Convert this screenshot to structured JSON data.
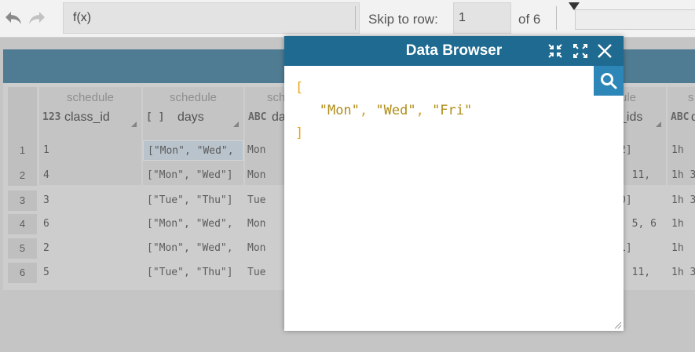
{
  "toolbar": {
    "formula": "f(x)",
    "skip_label": "Skip to row:",
    "skip_value": "1",
    "of_label": "of 6",
    "undo_icon": "undo-arrow-icon",
    "redo_icon": "redo-arrow-icon"
  },
  "grid": {
    "columns": [
      {
        "group": "schedule",
        "type": "123",
        "name": "class_id"
      },
      {
        "group": "schedule",
        "type": "[ ]",
        "name": "days"
      },
      {
        "group": "sche",
        "type": "ABC",
        "name": "da"
      },
      {
        "group": "ule",
        "type": "",
        "name": "_ids"
      },
      {
        "group": "s",
        "type": "ABC",
        "name": "d"
      }
    ],
    "rows": [
      {
        "num": "1",
        "class_id": "1",
        "days": "[\"Mon\", \"Wed\",",
        "da": "Mon",
        "ids": "2]",
        "d": "1h"
      },
      {
        "num": "2",
        "class_id": "4",
        "days": "[\"Mon\", \"Wed\"]",
        "da": "Mon",
        "ids": ", 11,",
        "d": "1h 3"
      },
      {
        "num": "3",
        "class_id": "3",
        "days": "[\"Tue\", \"Thu\"]",
        "da": "Tue",
        "ids": "0]",
        "d": "1h 3"
      },
      {
        "num": "4",
        "class_id": "6",
        "days": "[\"Mon\", \"Wed\",",
        "da": "Mon",
        "ids": ", 5, 6",
        "d": "1h"
      },
      {
        "num": "5",
        "class_id": "2",
        "days": "[\"Mon\", \"Wed\",",
        "da": "Mon",
        "ids": "1]",
        "d": "1h"
      },
      {
        "num": "6",
        "class_id": "5",
        "days": "[\"Tue\", \"Thu\"]",
        "da": "Tue",
        "ids": ", 11,",
        "d": "1h 3"
      }
    ]
  },
  "modal": {
    "title": "Data Browser",
    "open_bracket": "[",
    "close_bracket": "]",
    "values": [
      "\"Mon\"",
      "\"Wed\"",
      "\"Fri\""
    ],
    "separator": ", "
  },
  "colors": {
    "accent": "#1e6a91",
    "search_button": "#2d86b8",
    "json_bracket": "#e7a51c",
    "json_string": "#b08d17"
  }
}
